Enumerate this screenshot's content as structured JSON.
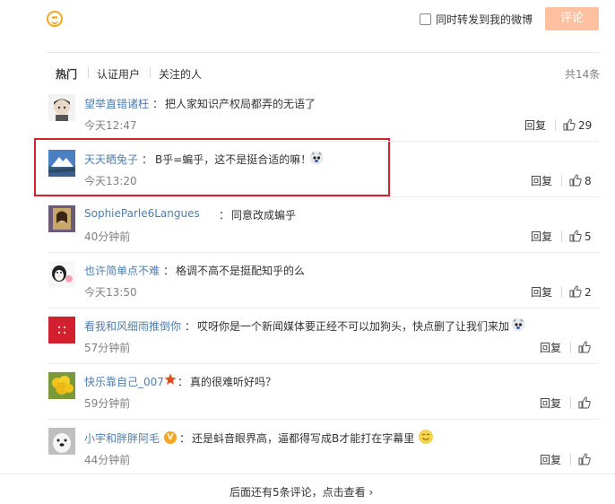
{
  "top": {
    "forward_label": "同时转发到我的微博",
    "comment_button": "评论"
  },
  "tabs": [
    {
      "label": "热门"
    },
    {
      "label": "认证用户"
    },
    {
      "label": "关注的人"
    }
  ],
  "total": "共14条",
  "comments": [
    {
      "user": "望举直错诸枉",
      "text": "把人家知识产权局都弄的无语了",
      "time": "今天12:47",
      "reply": "回复",
      "likes": "29"
    },
    {
      "user": "天天晒兔子",
      "text": "B乎=蝙乎，这不是挺合适的嘛！",
      "time": "今天13:20",
      "reply": "回复",
      "likes": "8"
    },
    {
      "user": "SophieParle6Langues",
      "text": "同意改成蝙乎",
      "time": "40分钟前",
      "reply": "回复",
      "likes": "5"
    },
    {
      "user": "也许简单点不难",
      "text": "格调不高不是挺配知乎的么",
      "time": "今天13:50",
      "reply": "回复",
      "likes": "2"
    },
    {
      "user": "看我和风细雨推倒你",
      "text": "哎呀你是一个新闻媒体要正经不可以加狗头，快点删了让我们来加",
      "time": "57分钟前",
      "reply": "回复",
      "likes": ""
    },
    {
      "user": "快乐靠自己_007",
      "text": "真的很难听好吗？",
      "time": "59分钟前",
      "reply": "回复",
      "likes": ""
    },
    {
      "user": "小宇和胖胖阿毛",
      "text": "还是蚪音眼界高，逼都得写成B才能打在字幕里",
      "time": "44分钟前",
      "reply": "回复",
      "likes": ""
    }
  ],
  "colon": "：",
  "footer": {
    "more_text": "后面还有5条评论，点击查看 ›"
  },
  "colors": {
    "accent": "#ffc09f",
    "username": "#507daf",
    "highlight": "#d8202a"
  }
}
